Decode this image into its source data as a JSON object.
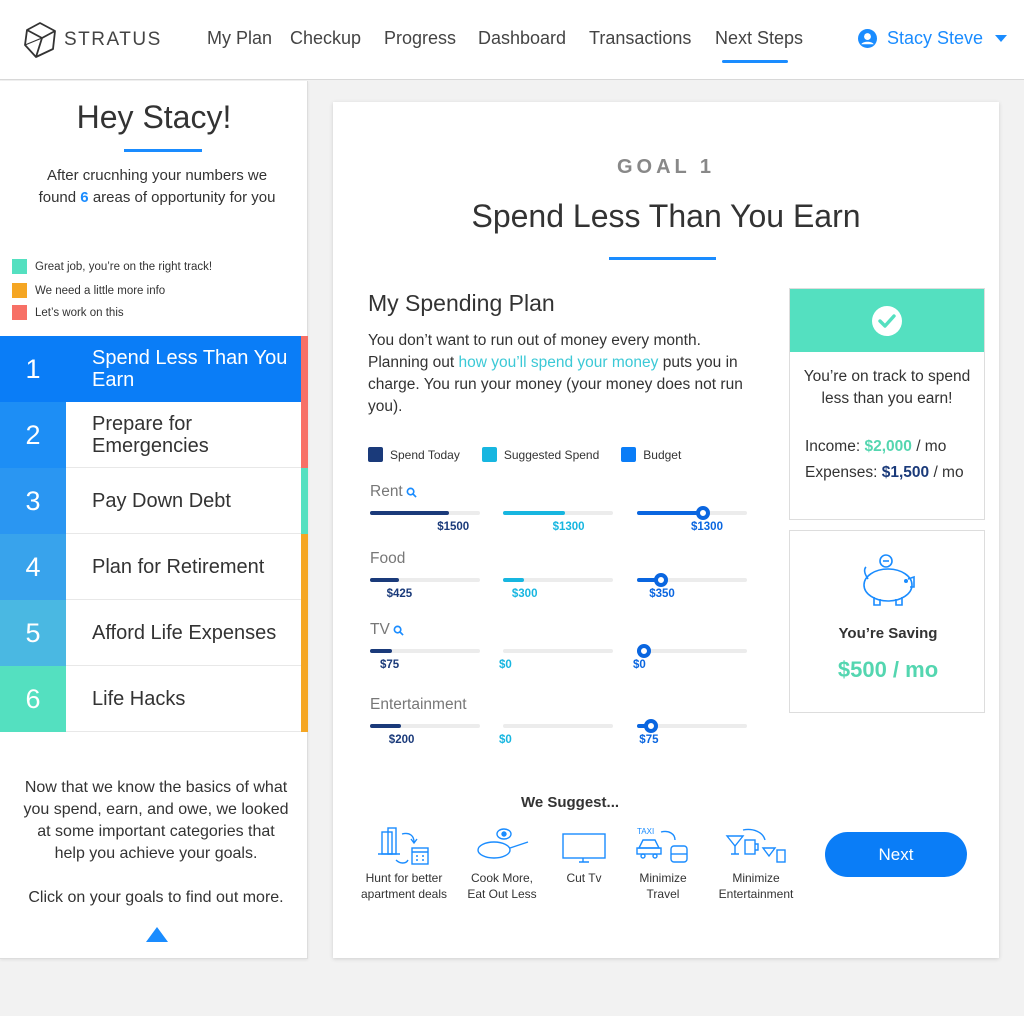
{
  "header": {
    "logo_text": "STRATUS",
    "nav": [
      "My Plan",
      "Checkup",
      "Progress",
      "Dashboard",
      "Transactions",
      "Next Steps"
    ],
    "active_nav": "Next Steps",
    "user_name": "Stacy Steve"
  },
  "sidebar": {
    "greeting": "Hey Stacy!",
    "intro_before": "After crucnhing your numbers we found",
    "intro_count": "6",
    "intro_after": "areas of opportunity for you",
    "legend": [
      {
        "label": "Great job, you’re on the right track!",
        "color": "#54e0c0"
      },
      {
        "label": "We need a little more info",
        "color": "#f5a623"
      },
      {
        "label": "Let’s work on this",
        "color": "#f77066"
      }
    ],
    "goals": [
      {
        "num": "1",
        "label": "Spend Less Than You Earn",
        "num_color": "#0a7df7",
        "status_color": "#f77066",
        "active": true
      },
      {
        "num": "2",
        "label": "Prepare for Emergencies",
        "num_color": "#1d8ef5",
        "status_color": "#f77066",
        "active": false
      },
      {
        "num": "3",
        "label": "Pay Down Debt",
        "num_color": "#2a96f2",
        "status_color": "#54e0c0",
        "active": false
      },
      {
        "num": "4",
        "label": "Plan for Retirement",
        "num_color": "#38a3ec",
        "status_color": "#f5a623",
        "active": false
      },
      {
        "num": "5",
        "label": "Afford Life Expenses",
        "num_color": "#4ab8e2",
        "status_color": "#f5a623",
        "active": false
      },
      {
        "num": "6",
        "label": "Life Hacks",
        "num_color": "#54e0c0",
        "status_color": "#f5a623",
        "active": false
      }
    ],
    "footer_1": "Now that we know the basics of what you spend, earn, and owe, we looked at some important categories that help you achieve your goals.",
    "footer_2": "Click on your goals to find out more."
  },
  "main": {
    "goal_label": "GOAL 1",
    "goal_title": "Spend Less Than You Earn",
    "plan_title": "My Spending Plan",
    "plan_desc_before": "You don’t want to run out of money every month. Planning out",
    "plan_desc_link": "how you’ll spend your money",
    "plan_desc_after": "puts you in charge. You run your money (your money does not run you).",
    "keys": [
      {
        "label": "Spend Today",
        "color": "#1a3a7a"
      },
      {
        "label": "Suggested Spend",
        "color": "#17b6e0"
      },
      {
        "label": "Budget",
        "color": "#0a7df7"
      }
    ],
    "categories": [
      {
        "name": "Rent",
        "search": true,
        "today": "$1500",
        "today_pct": 0.72,
        "suggested": "$1300",
        "suggested_pct": 0.56,
        "budget": "$1300",
        "budget_pct": 0.6
      },
      {
        "name": "Food",
        "search": false,
        "today": "$425",
        "today_pct": 0.26,
        "suggested": "$300",
        "suggested_pct": 0.19,
        "budget": "$350",
        "budget_pct": 0.22
      },
      {
        "name": "TV",
        "search": true,
        "today": "$75",
        "today_pct": 0.2,
        "suggested": "$0",
        "suggested_pct": 0.0,
        "budget": "$0",
        "budget_pct": 0.06
      },
      {
        "name": "Entertainment",
        "search": false,
        "today": "$200",
        "today_pct": 0.28,
        "suggested": "$0",
        "suggested_pct": 0.0,
        "budget": "$75",
        "budget_pct": 0.13
      }
    ],
    "suggest_title": "We Suggest...",
    "suggestions": [
      {
        "label_1": "Hunt for better",
        "label_2": "apartment deals"
      },
      {
        "label_1": "Cook More,",
        "label_2": "Eat Out Less"
      },
      {
        "label_1": "Cut Tv",
        "label_2": ""
      },
      {
        "label_1": "Minimize",
        "label_2": "Travel"
      },
      {
        "label_1": "Minimize",
        "label_2": "Entertainment"
      }
    ],
    "next_label": "Next",
    "status_text": "You’re on track to spend less than you earn!",
    "income_label": "Income:",
    "income_value": "$2,000",
    "expenses_label": "Expenses:",
    "expenses_value": "$1,500",
    "per_mo": "/ mo",
    "saving_label": "You’re Saving",
    "saving_value": "$500 / mo"
  }
}
